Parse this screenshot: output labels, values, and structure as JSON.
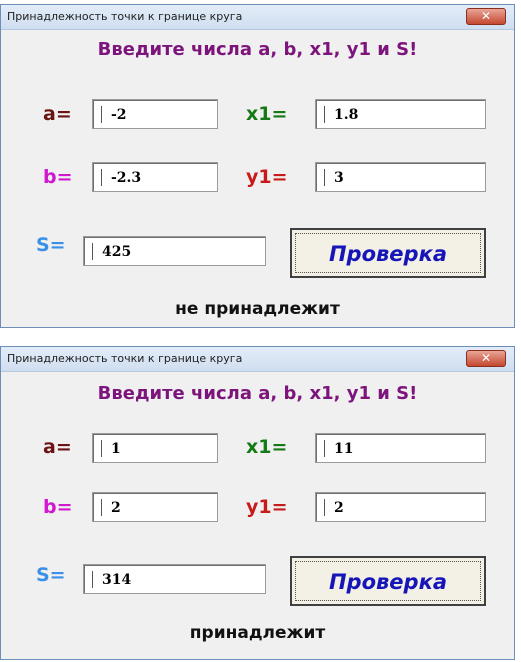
{
  "windows": [
    {
      "title": "Принадлежность точки к границе круга",
      "close_glyph": "✕",
      "heading": "Введите числа a, b, x1, y1  и S!",
      "labels": {
        "a": "a=",
        "b": "b=",
        "x1": "x1=",
        "y1": "y1=",
        "s": "S="
      },
      "fields": {
        "a": "-2",
        "b": "-2.3",
        "x1": "1.8",
        "y1": "3",
        "s": "425"
      },
      "button_label": "Проверка",
      "result": "не принадлежит"
    },
    {
      "title": "Принадлежность точки к границе круга",
      "close_glyph": "✕",
      "heading": "Введите числа a, b, x1, y1  и S!",
      "labels": {
        "a": "a=",
        "b": "b=",
        "x1": "x1=",
        "y1": "y1=",
        "s": "S="
      },
      "fields": {
        "a": "1",
        "b": "2",
        "x1": "11",
        "y1": "2",
        "s": "314"
      },
      "button_label": "Проверка",
      "result": "принадлежит"
    }
  ],
  "colors": {
    "heading": "#7c147c",
    "label_a": "#6a1414",
    "label_x1": "#157a15",
    "label_b": "#d018d0",
    "label_y1": "#c81a1a",
    "label_s": "#3a90e8",
    "button_text": "#1515b8"
  },
  "icons": {
    "close": "close-icon"
  }
}
